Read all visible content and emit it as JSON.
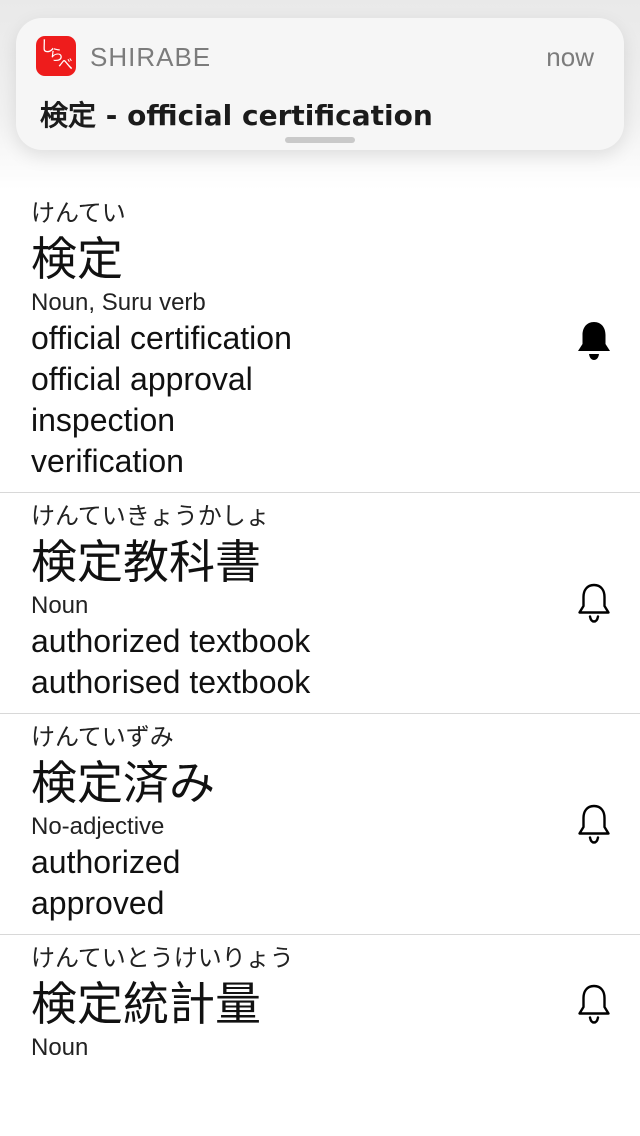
{
  "notification": {
    "app_name": "SHIRABE",
    "time": "now",
    "body": "検定 - official certification",
    "icon": "shirabe-app-icon",
    "icon_chars": [
      "し",
      "ら",
      "べ"
    ],
    "accent_color": "#ee1c1c"
  },
  "results": [
    {
      "reading": "けんてい",
      "word": "検定",
      "pos": "Noun, Suru verb",
      "meanings": [
        "official certification",
        "official approval",
        "inspection",
        "verification"
      ],
      "bell_icon": "bell-filled-icon",
      "bell_active": true
    },
    {
      "reading": "けんていきょうかしょ",
      "word": "検定教科書",
      "pos": "Noun",
      "meanings": [
        "authorized textbook",
        "authorised textbook"
      ],
      "bell_icon": "bell-outline-icon",
      "bell_active": false
    },
    {
      "reading": "けんていずみ",
      "word": "検定済み",
      "pos": "No-adjective",
      "meanings": [
        "authorized",
        "approved"
      ],
      "bell_icon": "bell-outline-icon",
      "bell_active": false
    },
    {
      "reading": "けんていとうけいりょう",
      "word": "検定統計量",
      "pos": "Noun",
      "meanings": [],
      "bell_icon": "bell-outline-icon",
      "bell_active": false
    }
  ]
}
